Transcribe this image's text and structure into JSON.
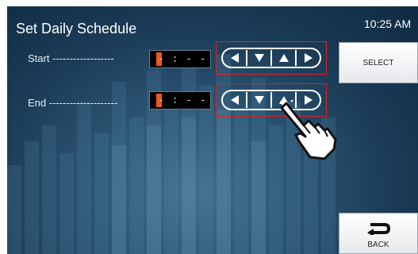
{
  "header": {
    "title": "Set Daily Schedule",
    "time": "10:25 AM"
  },
  "rows": [
    {
      "label": "Start ------------------",
      "time_value": "- : - -"
    },
    {
      "label": "End --------------------",
      "time_value": "- : - -"
    }
  ],
  "arrow_controls": [
    "left-arrow",
    "down-arrow",
    "up-arrow",
    "right-arrow"
  ],
  "buttons": {
    "select_label": "SELECT",
    "back_label": "BACK"
  },
  "colors": {
    "highlight_box": "#e02020",
    "cursor": "#f0561f"
  }
}
